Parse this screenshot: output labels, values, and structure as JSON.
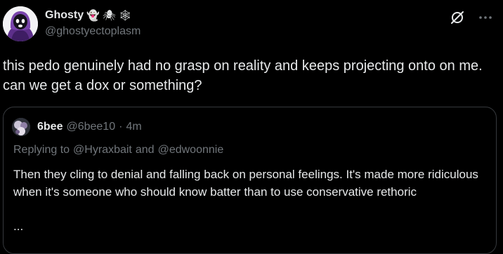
{
  "author": {
    "display_name": "Ghosty",
    "emojis": [
      "👻",
      "🕷",
      "🕸"
    ],
    "handle": "@ghostyectoplasm"
  },
  "actions": {
    "grok_icon": "grok-icon",
    "more_icon": "more-icon"
  },
  "post": {
    "text": "this pedo genuinely had no grasp on reality and keeps projecting onto on me. can we get a dox or something?"
  },
  "quote": {
    "display_name": "6bee",
    "handle": "@6bee10",
    "separator": "·",
    "time": "4m",
    "replying_prefix": "Replying to",
    "replying_user1": "@Hyraxbait",
    "replying_and": "and",
    "replying_user2": "@edwoonnie",
    "text": "Then they cling to denial and falling back on personal feelings. It's made more ridiculous when it's someone who should know batter than to use conservative rethoric",
    "more": "..."
  },
  "colors": {
    "background": "#000000",
    "primary_text": "#e7e9ea",
    "secondary_text": "#71767b",
    "border": "#36393d"
  }
}
